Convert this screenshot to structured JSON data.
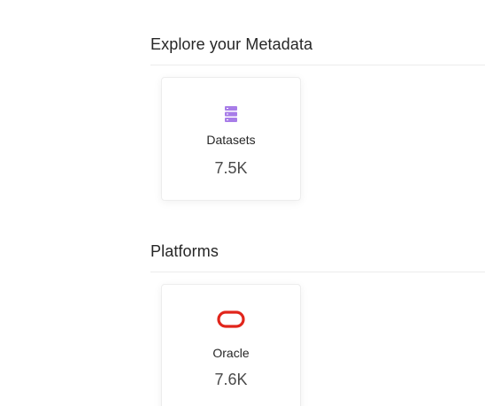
{
  "explore": {
    "title": "Explore your Metadata",
    "cards": [
      {
        "name": "Datasets",
        "count": "7.5K",
        "icon": "database-icon",
        "icon_color": "#a87de8"
      }
    ]
  },
  "platforms": {
    "title": "Platforms",
    "cards": [
      {
        "name": "Oracle",
        "count": "7.6K",
        "icon": "oracle-logo-icon",
        "icon_color": "#e1251b"
      }
    ]
  }
}
